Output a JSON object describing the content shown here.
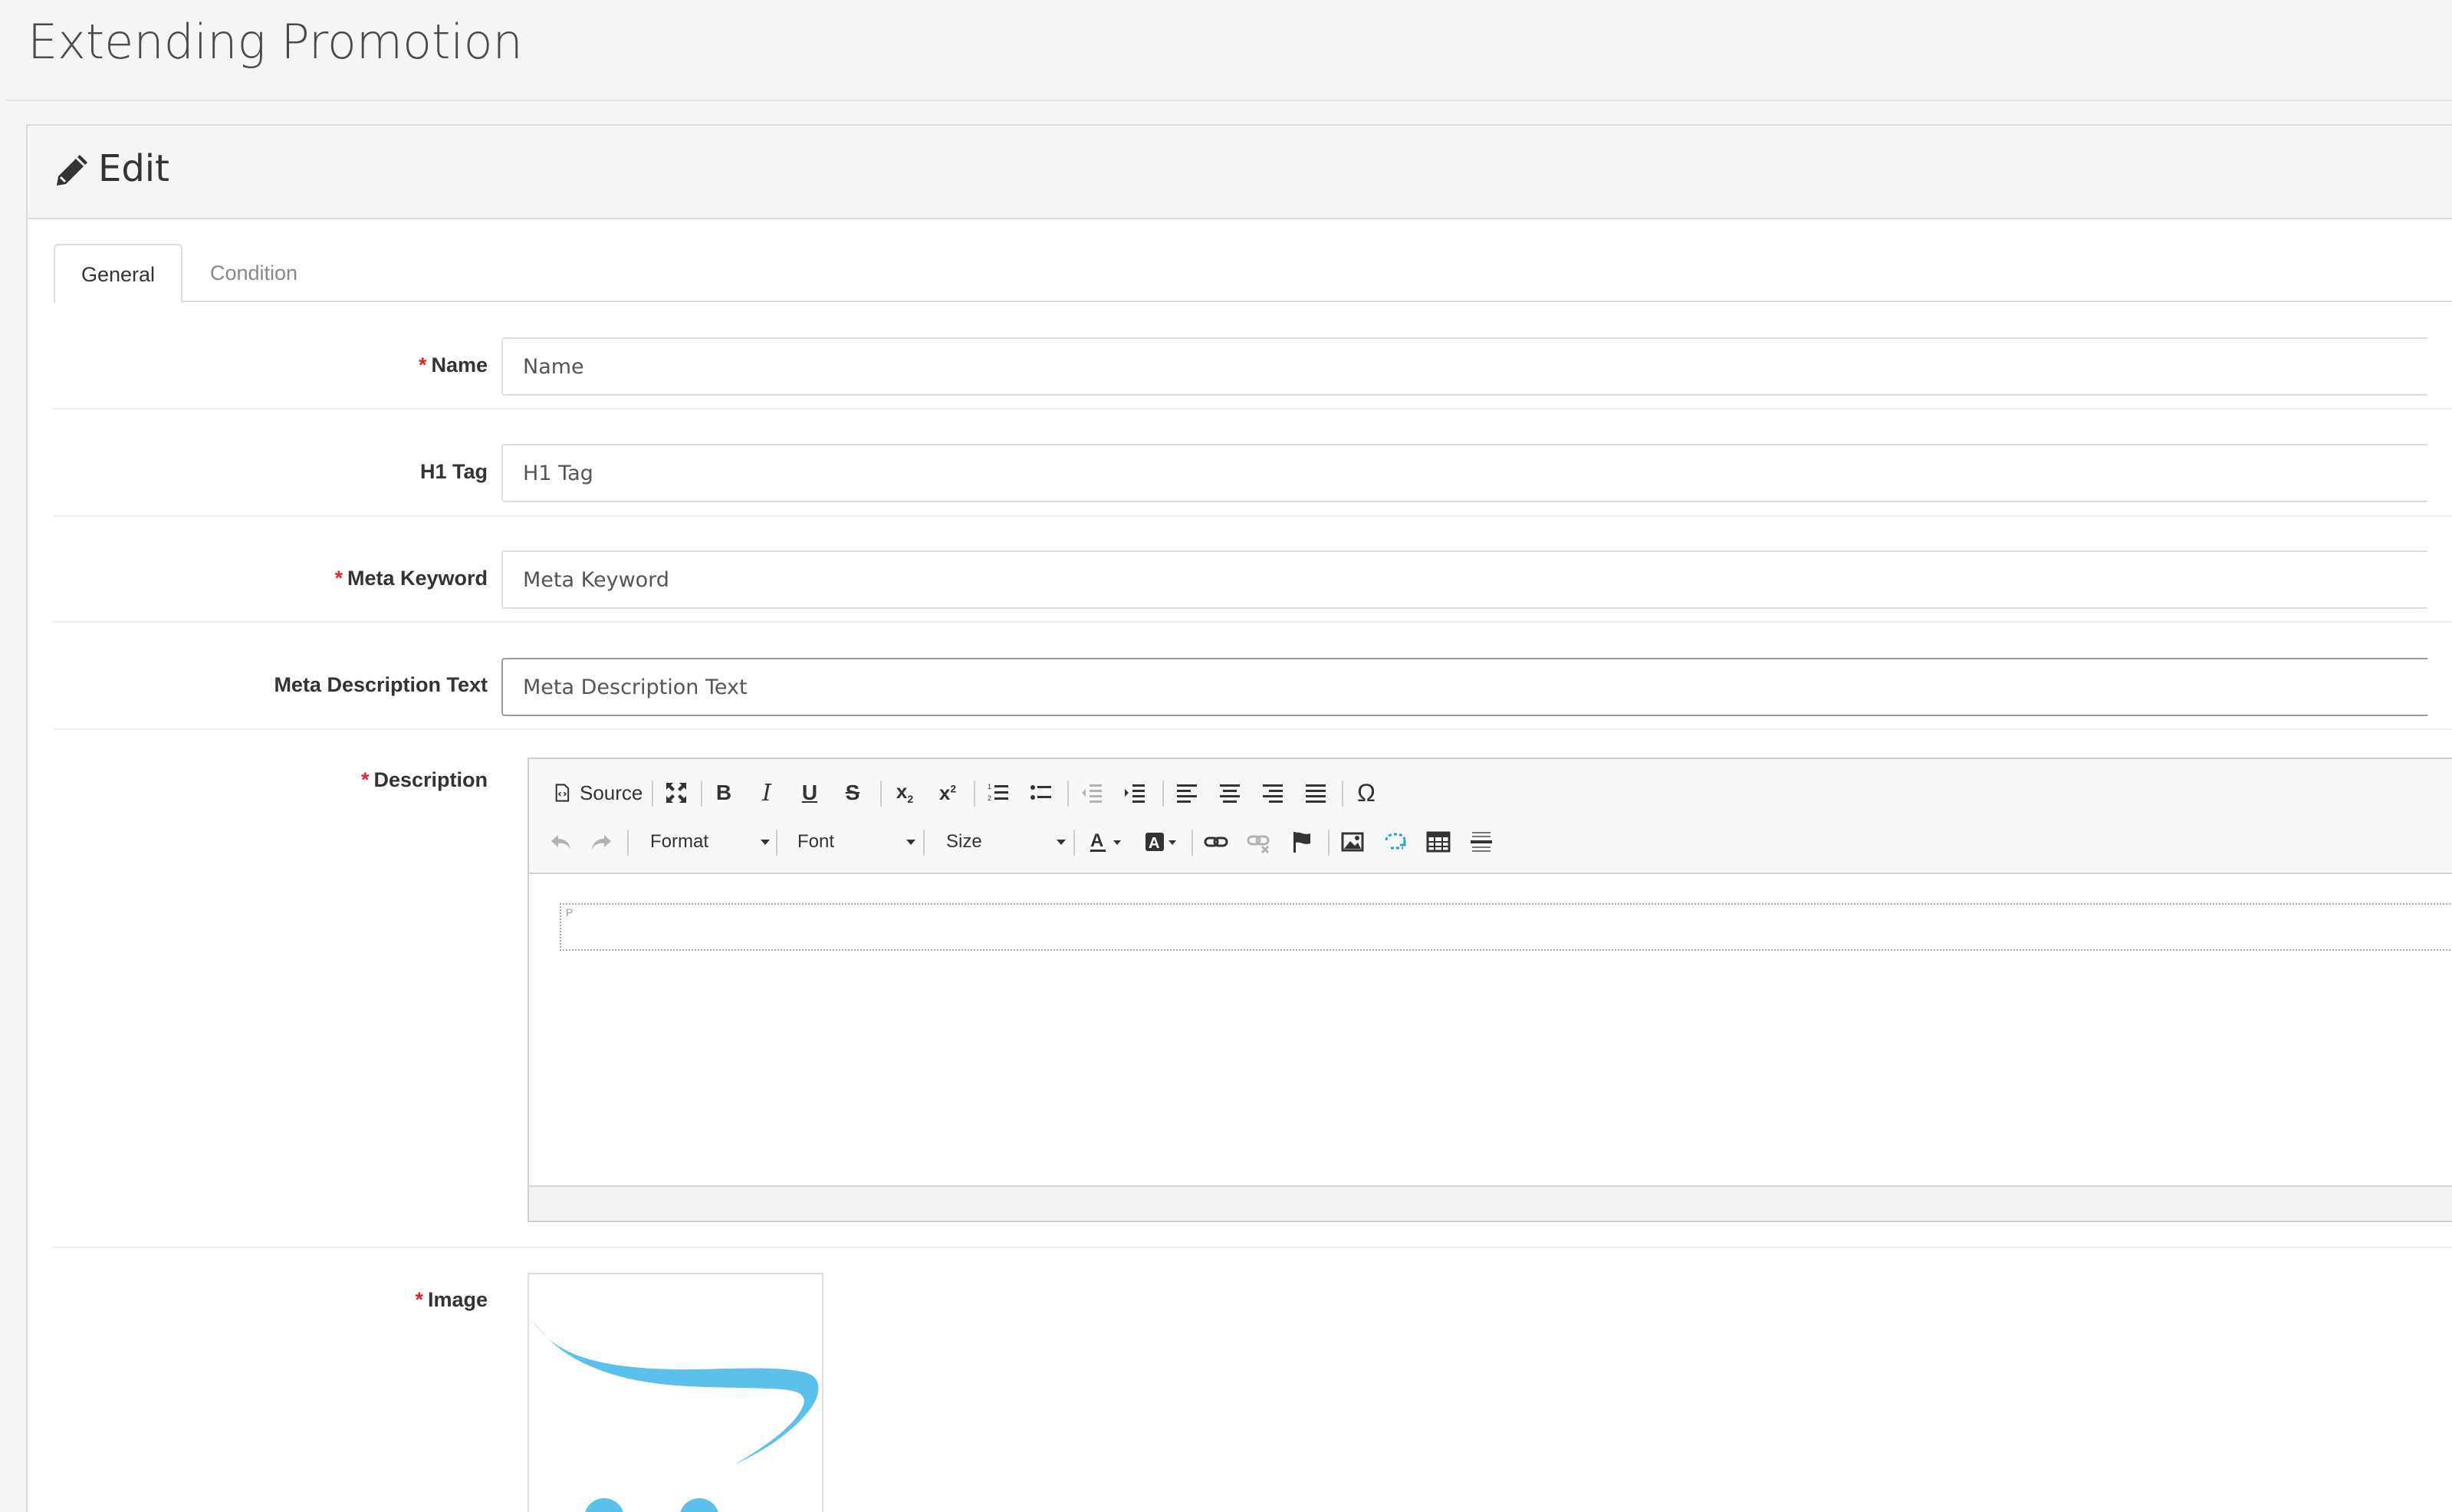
{
  "page": {
    "title": "Extending Promotion"
  },
  "panel": {
    "title": "Edit",
    "icon": "pencil-icon"
  },
  "tabs": [
    {
      "label": "General",
      "active": true
    },
    {
      "label": "Condition",
      "active": false
    }
  ],
  "form": {
    "name": {
      "label": "Name",
      "required": true,
      "placeholder": "Name",
      "value": ""
    },
    "h1_tag": {
      "label": "H1 Tag",
      "required": false,
      "placeholder": "H1 Tag",
      "value": ""
    },
    "meta_keyword": {
      "label": "Meta Keyword",
      "required": true,
      "placeholder": "Meta Keyword",
      "value": ""
    },
    "meta_description": {
      "label": "Meta Description Text",
      "required": false,
      "placeholder": "Meta Description Text",
      "value": ""
    },
    "description": {
      "label": "Description",
      "required": true,
      "toolbar": {
        "source_label": "Source",
        "format_label": "Format",
        "font_label": "Font",
        "size_label": "Size"
      },
      "block_tag": "P"
    },
    "image": {
      "label": "Image",
      "required": true
    }
  },
  "required_marker": "*",
  "colors": {
    "required": "#e3242b",
    "logo_blue": "#5bc0eb",
    "accent_link": "#2a9fd6"
  }
}
